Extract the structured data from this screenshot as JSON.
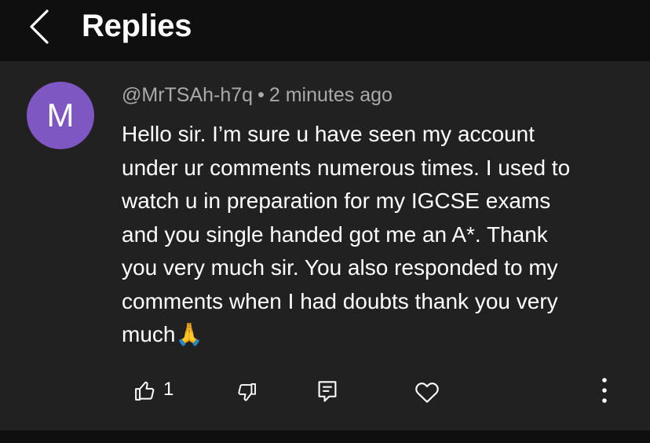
{
  "header": {
    "title": "Replies",
    "back_icon": "chevron-left-icon"
  },
  "comment": {
    "avatar_letter": "M",
    "avatar_color": "#7e57c2",
    "author": "@MrTSAh-h7q",
    "separator": "•",
    "time": "2 minutes ago",
    "text": "Hello sir. I’m sure u have seen my account\nunder ur comments numerous times. I used to\nwatch u in preparation for my IGCSE exams\nand you single handed got me an A*. Thank\nyou very much sir. You also responded to my\ncomments when I had doubts thank you very\nmuch🙏",
    "like_count": "1"
  },
  "actions": {
    "like_icon": "thumbs-up-icon",
    "dislike_icon": "thumbs-down-icon",
    "reply_icon": "reply-comment-icon",
    "heart_icon": "heart-icon",
    "more_icon": "more-vertical-icon"
  },
  "colors": {
    "background": "#000000",
    "header_bg": "#0f0f0f",
    "card_bg": "#212121",
    "meta_text": "#aaaaaa",
    "text": "#ffffff"
  }
}
